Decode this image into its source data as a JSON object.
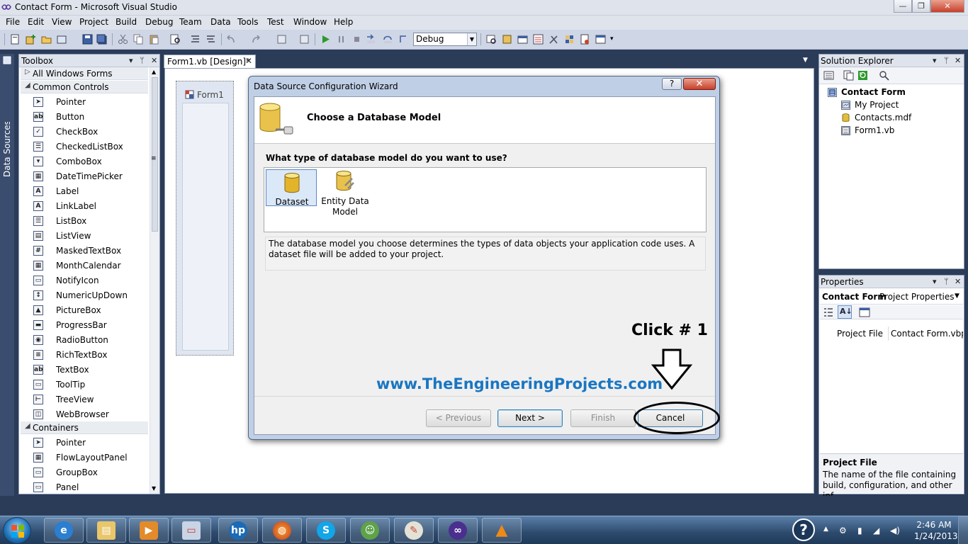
{
  "window": {
    "title": "Contact Form - Microsoft Visual Studio",
    "minimize": "—",
    "maximize": "❐",
    "close": "✕"
  },
  "menu": [
    "File",
    "Edit",
    "View",
    "Project",
    "Build",
    "Debug",
    "Team",
    "Data",
    "Tools",
    "Test",
    "Window",
    "Help"
  ],
  "toolbar": {
    "configuration": "Debug"
  },
  "side_strip": {
    "label": "Data Sources"
  },
  "toolbox": {
    "title": "Toolbox",
    "groups": {
      "all": "All Windows Forms",
      "common": "Common Controls",
      "containers": "Containers"
    },
    "common_items": [
      {
        "label": "Pointer",
        "icon": "pointer-icon",
        "glyph": "➤"
      },
      {
        "label": "Button",
        "icon": "button-icon",
        "glyph": "ab"
      },
      {
        "label": "CheckBox",
        "icon": "checkbox-icon",
        "glyph": "✓"
      },
      {
        "label": "CheckedListBox",
        "icon": "checkedlistbox-icon",
        "glyph": "☰"
      },
      {
        "label": "ComboBox",
        "icon": "combobox-icon",
        "glyph": "▾"
      },
      {
        "label": "DateTimePicker",
        "icon": "datetimepicker-icon",
        "glyph": "▦"
      },
      {
        "label": "Label",
        "icon": "label-icon",
        "glyph": "A"
      },
      {
        "label": "LinkLabel",
        "icon": "linklabel-icon",
        "glyph": "A"
      },
      {
        "label": "ListBox",
        "icon": "listbox-icon",
        "glyph": "☰"
      },
      {
        "label": "ListView",
        "icon": "listview-icon",
        "glyph": "▤"
      },
      {
        "label": "MaskedTextBox",
        "icon": "maskedtextbox-icon",
        "glyph": "#"
      },
      {
        "label": "MonthCalendar",
        "icon": "monthcalendar-icon",
        "glyph": "▦"
      },
      {
        "label": "NotifyIcon",
        "icon": "notifyicon-icon",
        "glyph": "▭"
      },
      {
        "label": "NumericUpDown",
        "icon": "numericupdown-icon",
        "glyph": "↕"
      },
      {
        "label": "PictureBox",
        "icon": "picturebox-icon",
        "glyph": "▲"
      },
      {
        "label": "ProgressBar",
        "icon": "progressbar-icon",
        "glyph": "▬"
      },
      {
        "label": "RadioButton",
        "icon": "radiobutton-icon",
        "glyph": "◉"
      },
      {
        "label": "RichTextBox",
        "icon": "richtextbox-icon",
        "glyph": "≡"
      },
      {
        "label": "TextBox",
        "icon": "textbox-icon",
        "glyph": "ab"
      },
      {
        "label": "ToolTip",
        "icon": "tooltip-icon",
        "glyph": "▭"
      },
      {
        "label": "TreeView",
        "icon": "treeview-icon",
        "glyph": "⊢"
      },
      {
        "label": "WebBrowser",
        "icon": "webbrowser-icon",
        "glyph": "◫"
      }
    ],
    "container_items": [
      {
        "label": "Pointer",
        "icon": "pointer-icon",
        "glyph": "➤"
      },
      {
        "label": "FlowLayoutPanel",
        "icon": "flowlayoutpanel-icon",
        "glyph": "▦"
      },
      {
        "label": "GroupBox",
        "icon": "groupbox-icon",
        "glyph": "▭"
      },
      {
        "label": "Panel",
        "icon": "panel-icon",
        "glyph": "▭"
      }
    ]
  },
  "document": {
    "tab": "Form1.vb [Design]*",
    "form_title": "Form1"
  },
  "solution_explorer": {
    "title": "Solution Explorer",
    "project": "Contact Form",
    "items": [
      "My Project",
      "Contacts.mdf",
      "Form1.vb"
    ]
  },
  "properties": {
    "title": "Properties",
    "object": "Contact Form",
    "object_type": "Project Properties",
    "row_name": "Project File",
    "row_value": "Contact Form.vbproj",
    "desc_title": "Project File",
    "desc_text": "The name of the file containing build, configuration, and other inf..."
  },
  "wizard": {
    "title": "Data Source Configuration Wizard",
    "help": "?",
    "close": "✕",
    "heading": "Choose a Database Model",
    "question": "What type of database model do you want to use?",
    "models": [
      {
        "label": "Dataset",
        "selected": true
      },
      {
        "label": "Entity Data Model",
        "selected": false
      }
    ],
    "description": "The database model you choose determines the types of data objects your application code uses. A dataset file will be added to your project.",
    "buttons": {
      "previous": "< Previous",
      "next": "Next >",
      "finish": "Finish",
      "cancel": "Cancel"
    }
  },
  "annotations": {
    "click": "Click # 1",
    "url": "www.TheEngineeringProjects.com"
  },
  "taskbar": {
    "time": "2:46 AM",
    "date": "1/24/2013",
    "help": "?"
  },
  "colors": {
    "accent": "#1a76c2",
    "frame": "#2b3c59"
  }
}
